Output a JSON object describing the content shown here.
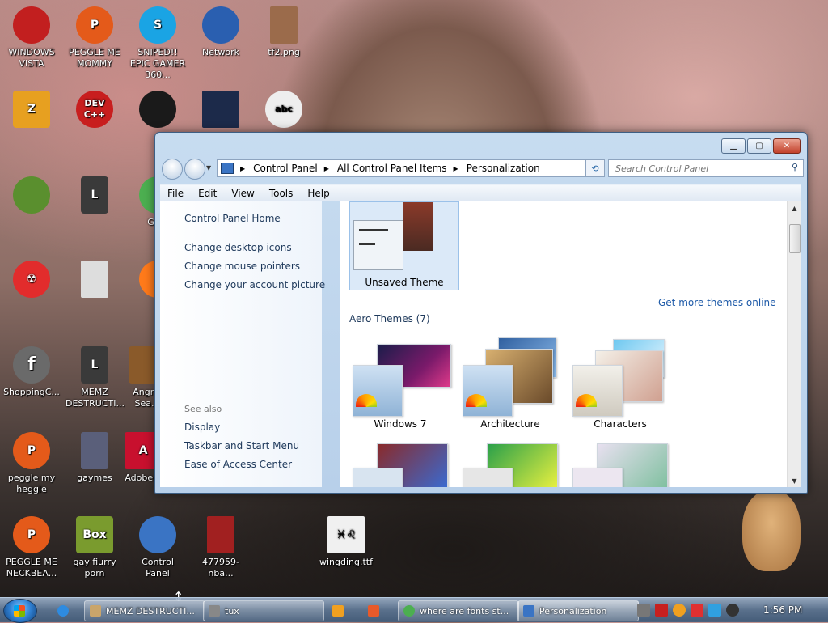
{
  "desktop": {
    "icons": [
      {
        "label": "WINDOWS VISTA",
        "color": "#c21f1f"
      },
      {
        "label": "PEGGLE ME MOMMY",
        "color": "#e45a1a"
      },
      {
        "label": "SNIPED!! EPIC GAMER 360...",
        "color": "#1aa4e4"
      },
      {
        "label": "Network",
        "color": "#2a5fb0"
      },
      {
        "label": "tf2.png",
        "color": "#9b6b4b"
      },
      {
        "label": "",
        "color": "#e7a020"
      },
      {
        "label": "",
        "color": "#c81e1e"
      },
      {
        "label": "",
        "color": "#1a1a1a"
      },
      {
        "label": "",
        "color": "#1c2a4a"
      },
      {
        "label": "",
        "color": "#eeeeee"
      },
      {
        "label": "",
        "color": "#5a8f2e"
      },
      {
        "label": "",
        "color": "#3a3a3a"
      },
      {
        "label": "Go...",
        "color": "#4caf50"
      },
      {
        "label": "",
        "color": "#e22c2c"
      },
      {
        "label": "",
        "color": "#dddddd"
      },
      {
        "label": "",
        "color": "#ff7a1a"
      },
      {
        "label": "ShoppingC...",
        "color": "#6a6a6a"
      },
      {
        "label": "MEMZ DESTRUCTI...",
        "color": "#3a3a3a"
      },
      {
        "label": "Angr... Sea...",
        "color": "#8a5a2a"
      },
      {
        "label": "peggle my heggle",
        "color": "#e45a1a"
      },
      {
        "label": "gaymes",
        "color": "#5a5f7a"
      },
      {
        "label": "Adobe...",
        "color": "#c8102e"
      },
      {
        "label": "PEGGLE ME NECKBEA...",
        "color": "#e45a1a"
      },
      {
        "label": "gay fiurry porn",
        "color": "#7a9b2e"
      },
      {
        "label": "Control Panel",
        "color": "#3a74c4"
      },
      {
        "label": "477959-nba...",
        "color": "#a12020"
      },
      {
        "label": "wingding.ttf",
        "color": "#f0f0f0"
      }
    ]
  },
  "window": {
    "title": "Personalization",
    "address": {
      "items": [
        "Control Panel",
        "All Control Panel Items",
        "Personalization"
      ]
    },
    "search_placeholder": "Search Control Panel",
    "menu": [
      "File",
      "Edit",
      "View",
      "Tools",
      "Help"
    ],
    "left_pane": {
      "home": "Control Panel Home",
      "links": [
        "Change desktop icons",
        "Change mouse pointers",
        "Change your account picture"
      ],
      "see_also": "See also",
      "see_also_links": [
        "Display",
        "Taskbar and Start Menu",
        "Ease of Access Center"
      ]
    },
    "content": {
      "unsaved_theme": "Unsaved Theme",
      "get_more": "Get more themes online",
      "aero_header": "Aero Themes (7)",
      "themes": [
        "Windows 7",
        "Architecture",
        "Characters"
      ]
    }
  },
  "taskbar": {
    "buttons": [
      {
        "label": "MEMZ DESTRUCTI...",
        "color": "#c9a56b"
      },
      {
        "label": "tux",
        "color": "#888888"
      },
      {
        "label": "where are fonts st...",
        "color": "#4caf50"
      },
      {
        "label": "Personalization",
        "color": "#3a74c4"
      }
    ],
    "clock": "1:56 PM"
  }
}
